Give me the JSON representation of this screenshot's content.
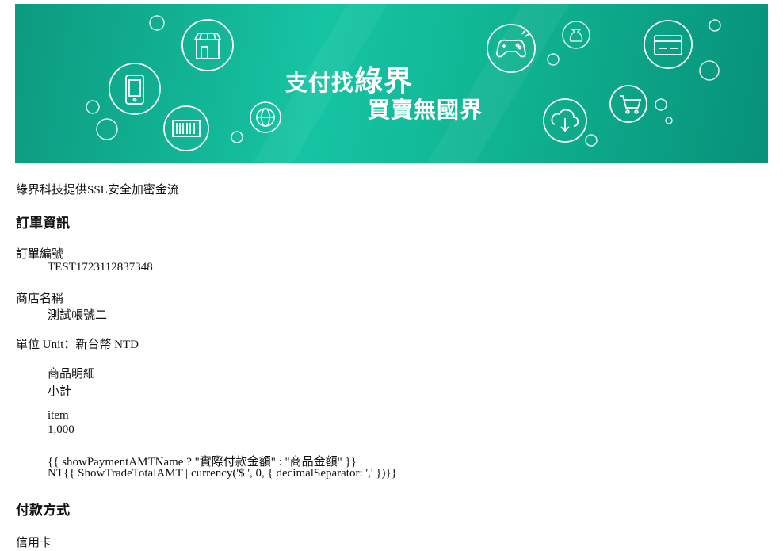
{
  "banner": {
    "line1_prefix": "支付找",
    "line1_emphasis": "綠界",
    "line2": "買賣無國界"
  },
  "ssl_notice": "綠界科技提供SSL安全加密金流",
  "order_info": {
    "heading": "訂單資訊",
    "order_no_label": "訂單編號",
    "order_no_value": "TEST1723112837348",
    "store_label": "商店名稱",
    "store_value": "測試帳號二",
    "unit_text": "單位 Unit：新台幣 NTD",
    "detail_header": "商品明細",
    "subtotal_header": "小計",
    "item_name": "item",
    "item_amount": "1,000",
    "total_label": "{{ showPaymentAMTName ? \"實際付款金額\" : \"商品金額\" }}",
    "total_value": "NT{{ ShowTradeTotalAMT | currency('$ ', 0, { decimalSeparator: ',' })}}"
  },
  "payment": {
    "heading": "付款方式",
    "method": "信用卡"
  },
  "colors": {
    "banner_green": "#10b694",
    "text": "#111111"
  }
}
